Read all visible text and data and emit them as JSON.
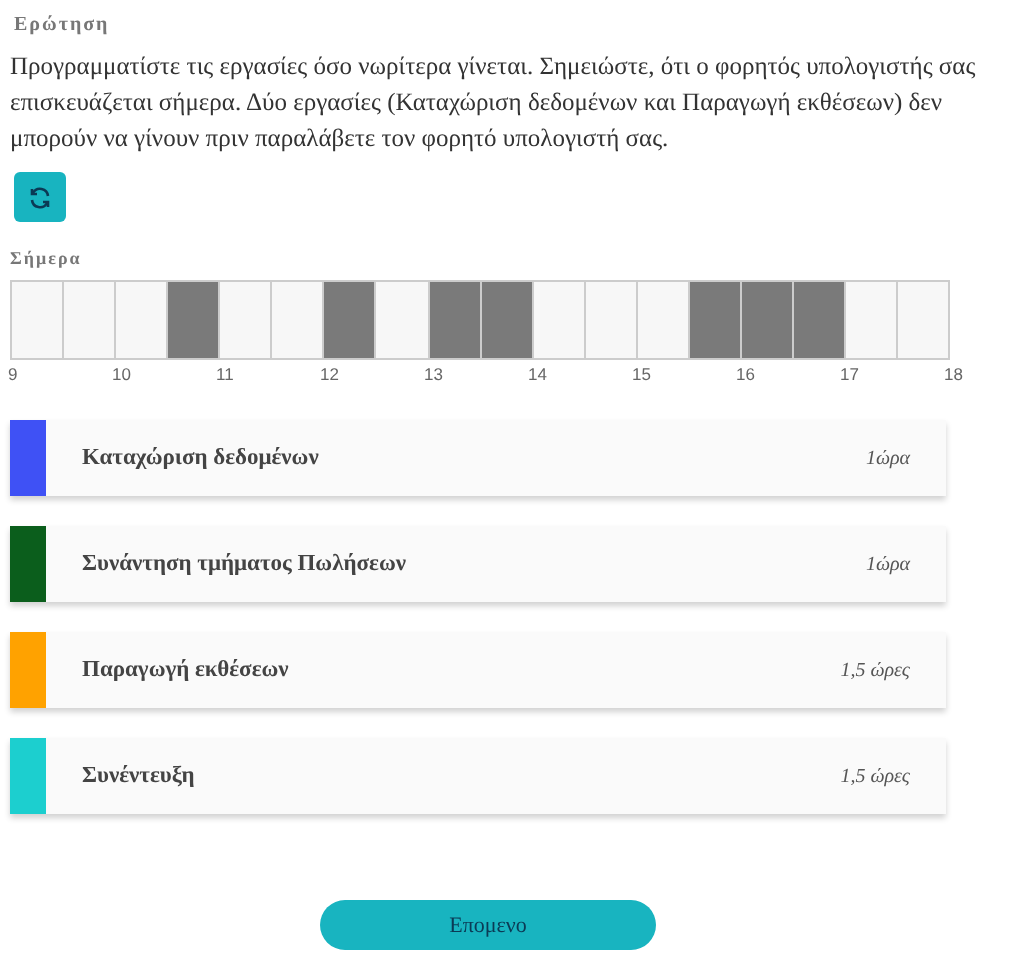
{
  "heading": "Ερώτηση",
  "question": "Προγραμματίστε τις εργασίες όσο νωρίτερα γίνεται. Σημειώστε, ότι ο φορητός υπολογιστής σας επισκευάζεται σήμερα. Δύο εργασίες (Καταχώριση δεδομένων και Παραγωγή εκθέσεων) δεν μπορούν να γίνουν πριν παραλάβετε τον φορητό υπολογιστή σας.",
  "day_label": "Σήμερα",
  "slots": [
    {
      "busy": false
    },
    {
      "busy": false
    },
    {
      "busy": false
    },
    {
      "busy": true
    },
    {
      "busy": false
    },
    {
      "busy": false
    },
    {
      "busy": true
    },
    {
      "busy": false
    },
    {
      "busy": true
    },
    {
      "busy": true
    },
    {
      "busy": false
    },
    {
      "busy": false
    },
    {
      "busy": false
    },
    {
      "busy": true
    },
    {
      "busy": true
    },
    {
      "busy": true
    },
    {
      "busy": false
    },
    {
      "busy": false
    }
  ],
  "hours": [
    "9",
    "10",
    "11",
    "12",
    "13",
    "14",
    "15",
    "16",
    "17",
    "18"
  ],
  "tasks": [
    {
      "name": "Καταχώριση δεδομένων",
      "duration": "1ώρα",
      "color": "#3f51f5"
    },
    {
      "name": "Συνάντηση τμήματος Πωλήσεων",
      "duration": "1ώρα",
      "color": "#0b5e1c"
    },
    {
      "name": "Παραγωγή εκθέσεων",
      "duration": "1,5 ώρες",
      "color": "#ffa200"
    },
    {
      "name": "Συνέντευξη",
      "duration": "1,5 ώρες",
      "color": "#1ccfcf"
    }
  ],
  "next_button": "Επομενο"
}
